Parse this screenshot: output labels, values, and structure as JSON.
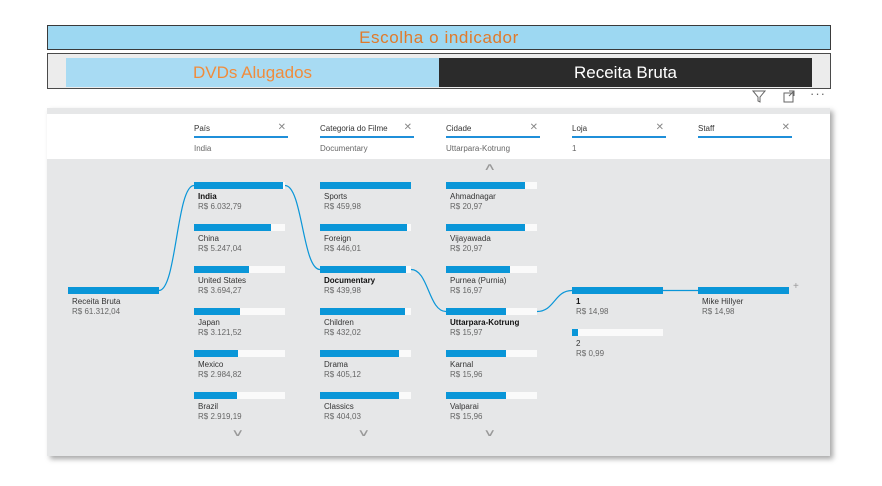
{
  "header": {
    "title": "Escolha o indicador"
  },
  "slicer": {
    "options": [
      "DVDs Alugados",
      "Receita Bruta"
    ],
    "selected": "Receita Bruta"
  },
  "visual_icons": [
    "filter-icon",
    "focus-mode-icon",
    "more-options-icon"
  ],
  "filters": [
    {
      "label": "País",
      "value": "India"
    },
    {
      "label": "Categoria do Filme",
      "value": "Documentary"
    },
    {
      "label": "Cidade",
      "value": "Uttarpara-Kotrung"
    },
    {
      "label": "Loja",
      "value": "1"
    },
    {
      "label": "Staff",
      "value": ""
    }
  ],
  "root": {
    "label": "Receita Bruta",
    "value": "R$ 61.312,04",
    "fraction": 1
  },
  "columns": [
    {
      "nodes": [
        {
          "label": "India",
          "value": "R$ 6.032,79",
          "fraction": 0.98,
          "selected": true
        },
        {
          "label": "China",
          "value": "R$ 5.247,04",
          "fraction": 0.85
        },
        {
          "label": "United States",
          "value": "R$ 3.694,27",
          "fraction": 0.6
        },
        {
          "label": "Japan",
          "value": "R$ 3.121,52",
          "fraction": 0.5
        },
        {
          "label": "Mexico",
          "value": "R$ 2.984,82",
          "fraction": 0.48
        },
        {
          "label": "Brazil",
          "value": "R$ 2.919,19",
          "fraction": 0.47
        }
      ]
    },
    {
      "nodes": [
        {
          "label": "Sports",
          "value": "R$ 459,98",
          "fraction": 1
        },
        {
          "label": "Foreign",
          "value": "R$ 446,01",
          "fraction": 0.96
        },
        {
          "label": "Documentary",
          "value": "R$ 439,98",
          "fraction": 0.95,
          "selected": true
        },
        {
          "label": "Children",
          "value": "R$ 432,02",
          "fraction": 0.93
        },
        {
          "label": "Drama",
          "value": "R$ 405,12",
          "fraction": 0.87
        },
        {
          "label": "Classics",
          "value": "R$ 404,03",
          "fraction": 0.87
        }
      ]
    },
    {
      "nodes": [
        {
          "label": "Ahmadnagar",
          "value": "R$ 20,97",
          "fraction": 0.87
        },
        {
          "label": "Vijayawada",
          "value": "R$ 20,97",
          "fraction": 0.87
        },
        {
          "label": "Purnea (Purnia)",
          "value": "R$ 16,97",
          "fraction": 0.7
        },
        {
          "label": "Uttarpara-Kotrung",
          "value": "R$ 15,97",
          "fraction": 0.66,
          "selected": true
        },
        {
          "label": "Karnal",
          "value": "R$ 15,96",
          "fraction": 0.66
        },
        {
          "label": "Valparai",
          "value": "R$ 15,96",
          "fraction": 0.66
        }
      ]
    },
    {
      "nodes": [
        {
          "label": "1",
          "value": "R$ 14,98",
          "fraction": 1,
          "selected": true
        },
        {
          "label": "2",
          "value": "R$ 0,99",
          "fraction": 0.07
        }
      ]
    },
    {
      "nodes": [
        {
          "label": "Mike Hillyer",
          "value": "R$ 14,98",
          "fraction": 1
        }
      ]
    }
  ],
  "colors": {
    "bar": "#0a96d8",
    "accent": "#e07a2b",
    "header_bg": "#9dd8f2"
  }
}
